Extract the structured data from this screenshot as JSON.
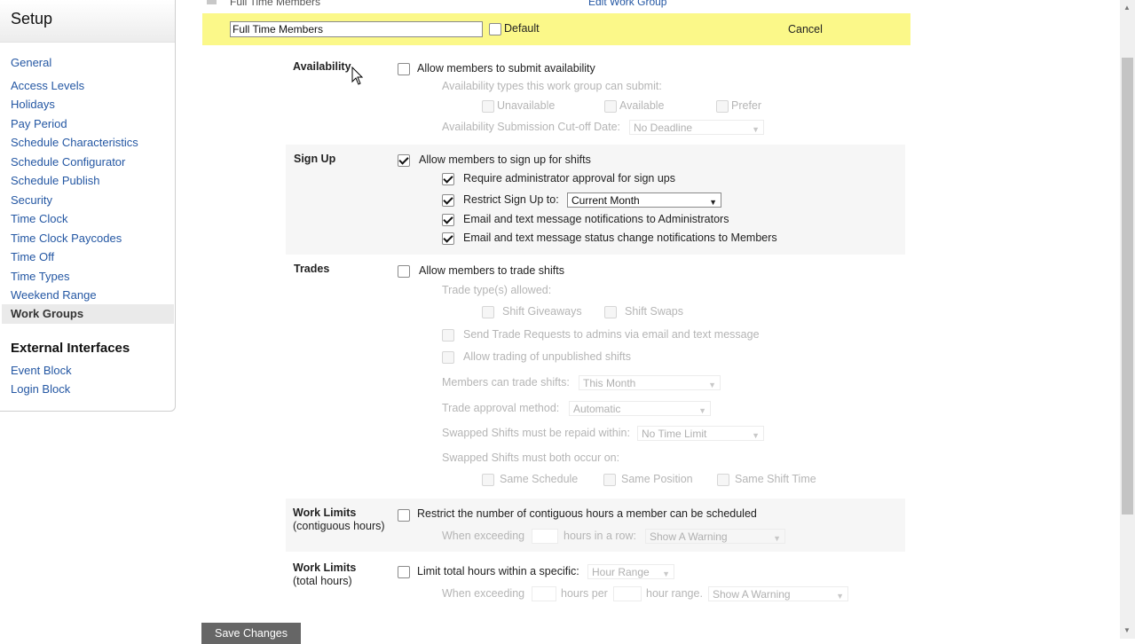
{
  "sidebar": {
    "title": "Setup",
    "items": [
      {
        "label": "General"
      },
      {
        "label": "Access Levels"
      },
      {
        "label": "Holidays"
      },
      {
        "label": "Pay Period"
      },
      {
        "label": "Schedule Characteristics"
      },
      {
        "label": "Schedule Configurator"
      },
      {
        "label": "Schedule Publish"
      },
      {
        "label": "Security"
      },
      {
        "label": "Time Clock"
      },
      {
        "label": "Time Clock Paycodes"
      },
      {
        "label": "Time Off"
      },
      {
        "label": "Time Types"
      },
      {
        "label": "Weekend Range"
      },
      {
        "label": "Work Groups"
      }
    ],
    "active_item": "Work Groups",
    "external_heading": "External Interfaces",
    "external_items": [
      {
        "label": "Event Block"
      },
      {
        "label": "Login Block"
      }
    ]
  },
  "top": {
    "prev_row_name": "Full Time Members",
    "edit_link": "Edit Work Group"
  },
  "edit_bar": {
    "name_value": "Full Time Members",
    "default_label": "Default",
    "default_checked": false,
    "cancel_label": "Cancel"
  },
  "availability": {
    "title": "Availability",
    "allow_label": "Allow members to submit availability",
    "allow_checked": false,
    "types_label": "Availability types this work group can submit:",
    "types": [
      "Unavailable",
      "Available",
      "Prefer"
    ],
    "cutoff_label": "Availability Submission Cut-off Date:",
    "cutoff_value": "No Deadline"
  },
  "signup": {
    "title": "Sign Up",
    "allow_label": "Allow members to sign up for shifts",
    "allow_checked": true,
    "require_label": "Require administrator approval for sign ups",
    "restrict_label": "Restrict Sign Up to:",
    "restrict_value": "Current Month",
    "email_admin_label": "Email and text message notifications to Administrators",
    "email_members_label": "Email and text message status change notifications to Members"
  },
  "trades": {
    "title": "Trades",
    "allow_label": "Allow members to trade shifts",
    "allow_checked": false,
    "types_label": "Trade type(s) allowed:",
    "types": [
      "Shift Giveaways",
      "Shift Swaps"
    ],
    "send_label": "Send Trade Requests to admins via email and text message",
    "unpublished_label": "Allow trading of unpublished shifts",
    "members_trade_label": "Members can trade shifts:",
    "members_trade_value": "This Month",
    "approval_label": "Trade approval method:",
    "approval_value": "Automatic",
    "repaid_label": "Swapped Shifts must be repaid within:",
    "repaid_value": "No Time Limit",
    "both_label": "Swapped Shifts must both occur on:",
    "both_options": [
      "Same Schedule",
      "Same Position",
      "Same Shift Time"
    ]
  },
  "work_limits_contig": {
    "title": "Work Limits",
    "subtitle": "(contiguous hours)",
    "restrict_label": "Restrict the number of contiguous hours a member can be scheduled",
    "when_label": "When exceeding",
    "hours_label": "hours in a row:",
    "action_value": "Show A Warning"
  },
  "work_limits_total": {
    "title": "Work Limits",
    "subtitle": "(total hours)",
    "limit_label": "Limit total hours within a specific:",
    "range_value": "Hour Range",
    "when_label": "When exceeding",
    "hours_per_label": "hours per",
    "range_label": "hour range.",
    "action_value": "Show A Warning"
  },
  "footer": {
    "save_label": "Save Changes"
  },
  "colors": {
    "link": "#2457a3",
    "edit_bar": "#fbf889",
    "button": "#666666"
  }
}
